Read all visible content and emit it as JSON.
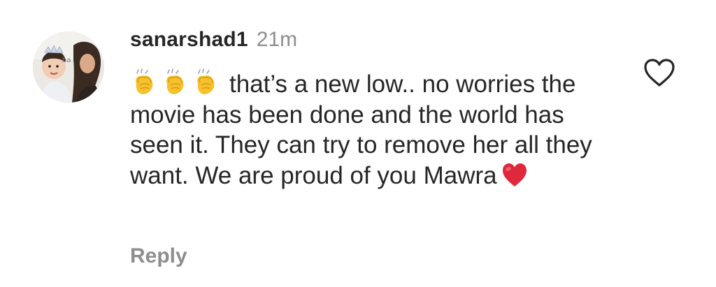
{
  "comment": {
    "username": "sanarshad1",
    "timestamp": "21m",
    "text": "that’s a new low.. no worries the movie has been done and the world has seen it. They can try to remove her all they want. We are proud of you Mawra",
    "leading_emojis": [
      "clapping-hands",
      "clapping-hands",
      "clapping-hands"
    ],
    "trailing_emoji": "red-heart",
    "reply_label": "Reply",
    "like_icon": "heart-outline-icon"
  },
  "colors": {
    "text": "#262626",
    "secondary": "#8e8e8e",
    "heart_red": "#e0283c",
    "clap_yellow": "#f4b71a"
  }
}
